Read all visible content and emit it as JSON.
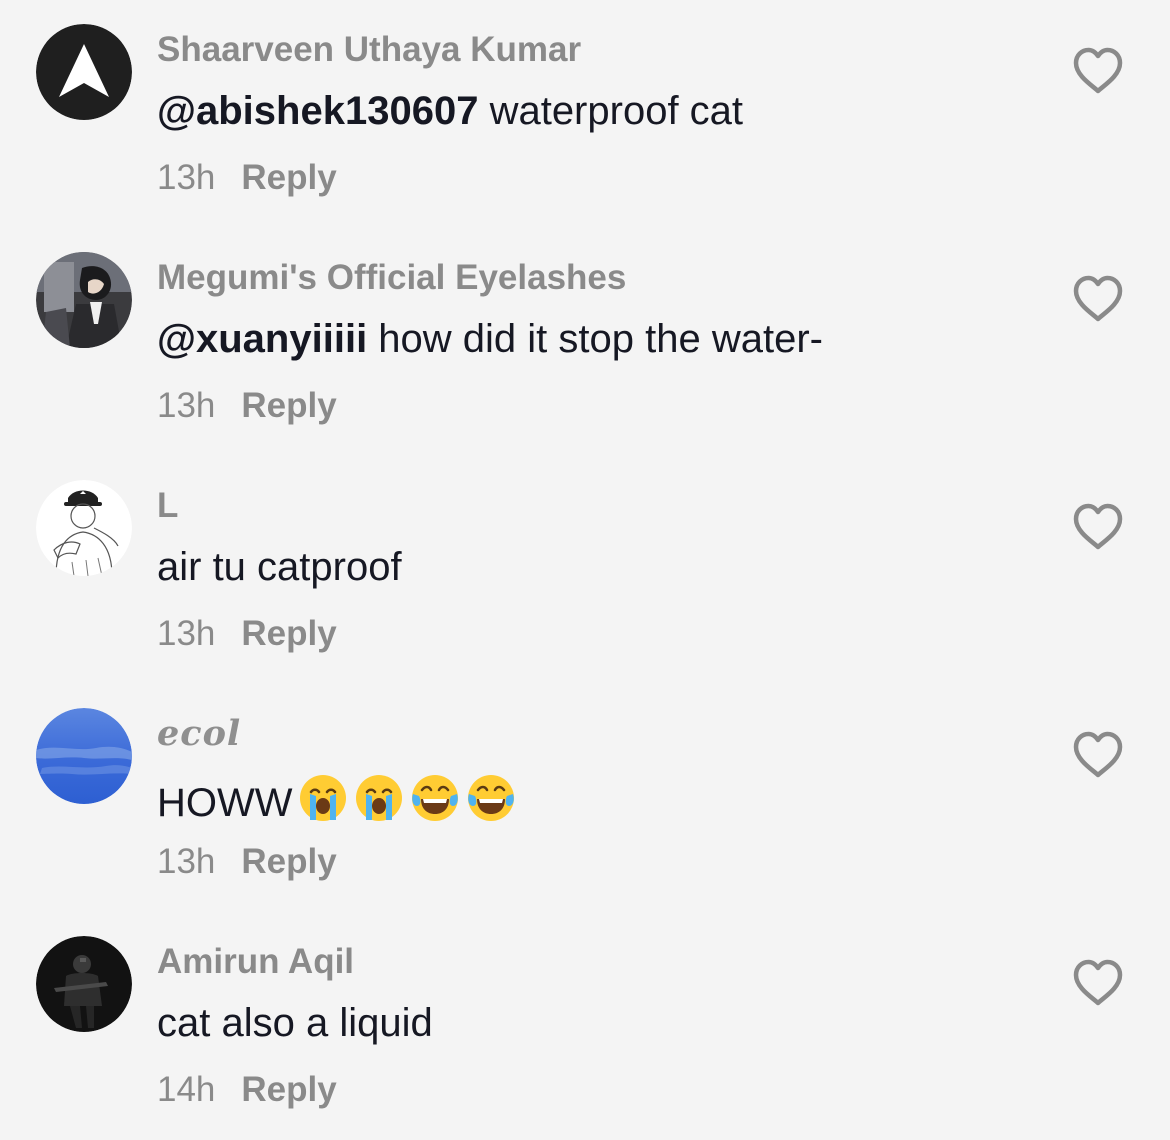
{
  "comments": [
    {
      "username": "Shaarveen Uthaya Kumar",
      "mention": "@abishek130607",
      "text": " waterproof cat",
      "time": "13h",
      "reply_label": "Reply"
    },
    {
      "username": "Megumi's Official Eyelashes",
      "mention": "@xuanyiiiii",
      "text": " how did it stop the water-",
      "time": "13h",
      "reply_label": "Reply"
    },
    {
      "username": "L",
      "text": "air tu catproof",
      "time": "13h",
      "reply_label": "Reply"
    },
    {
      "username": "ecol",
      "text": "HOWW",
      "emojis": [
        "loudly-crying-face",
        "loudly-crying-face",
        "face-with-tears-of-joy",
        "face-with-tears-of-joy"
      ],
      "time": "13h",
      "reply_label": "Reply"
    },
    {
      "username": "Amirun Aqil",
      "text": "cat also a liquid",
      "time": "14h",
      "reply_label": "Reply"
    }
  ],
  "icons": {
    "like": "heart-outline-icon"
  },
  "colors": {
    "background": "#f4f4f4",
    "username": "#8a8a8a",
    "text": "#161823",
    "meta": "#8a8a8a",
    "heart_stroke": "#8a8a8a"
  }
}
